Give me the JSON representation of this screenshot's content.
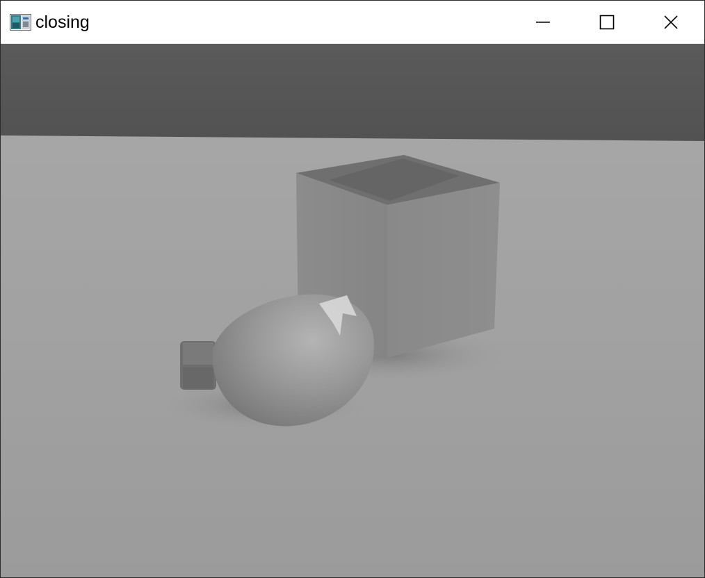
{
  "window": {
    "title": "closing",
    "icons": {
      "app": "image-viewer-icon",
      "minimize": "minimize-icon",
      "maximize": "maximize-icon",
      "close": "close-icon"
    }
  },
  "image": {
    "description_icon": "grayscale-image"
  }
}
